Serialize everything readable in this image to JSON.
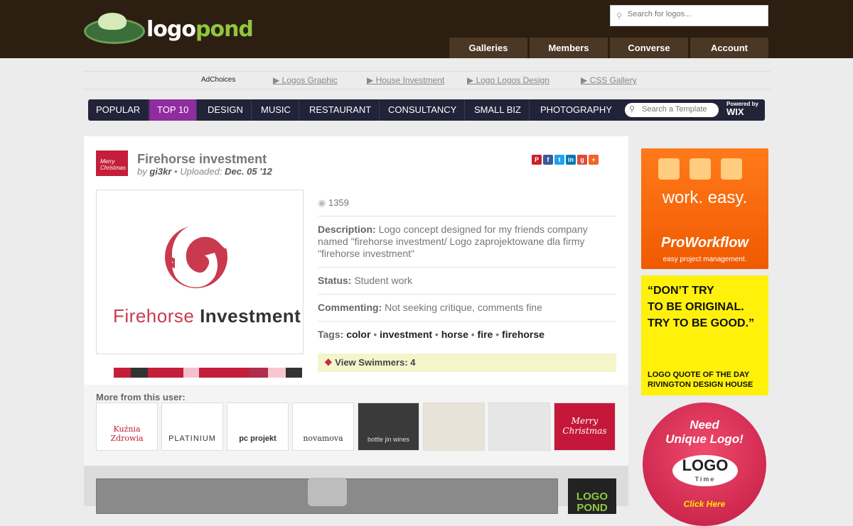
{
  "header": {
    "logo_white": "logo",
    "logo_green": "pond",
    "search_placeholder": "Search for logos...",
    "nav": [
      "Galleries",
      "Members",
      "Converse",
      "Account"
    ]
  },
  "adbar": {
    "adchoices": "AdChoices",
    "links": [
      "▶ Logos Graphic",
      "▶ House Investment",
      "▶ Logo Logos Design",
      "▶ CSS Gallery"
    ]
  },
  "categories": {
    "items": [
      "POPULAR",
      "TOP 10",
      "DESIGN",
      "MUSIC",
      "RESTAURANT",
      "CONSULTANCY",
      "SMALL BIZ",
      "PHOTOGRAPHY"
    ],
    "active": "TOP 10",
    "search_placeholder": "Search a Template",
    "wix_top": "Powered by",
    "wix": "WIX"
  },
  "logo_page": {
    "avatar_text": "Merry Christmas",
    "title": "Firehorse investment",
    "by_prefix": "by",
    "author": "gi3kr",
    "uploaded_prefix": " • Uploaded:",
    "uploaded_date": "Dec. 05 '12",
    "logo_word1": "Firehorse",
    "logo_word2": "Investment",
    "swatch_colors": [
      "#c41e3a",
      "#333333",
      "#c41e3a",
      "#f3c0cb",
      "#c41e3a",
      "#b12d4d",
      "#c41e3a",
      "#f7c6d0",
      "#333333"
    ],
    "views": "1359",
    "description_label": "Description:",
    "description": "Logo concept designed for my friends company named \"firehorse investment/ Logo zaprojektowane dla firmy \"firehorse investment\"",
    "status_label": "Status:",
    "status": "Student work",
    "commenting_label": "Commenting:",
    "commenting": "Not seeking critique, comments fine",
    "tags_label": "Tags:",
    "tags": [
      "color",
      "investment",
      "horse",
      "fire",
      "firehorse"
    ],
    "swimmers": "View Swimmers: 4"
  },
  "more": {
    "heading": "More from this user:",
    "thumbs": [
      "Kuźnia Zdrowia",
      "PLATINIUM",
      "pc projekt",
      "novamova",
      "bottle jin wines",
      "",
      "",
      "Merry Christmas"
    ]
  },
  "bottom": {
    "lp_small": "LOGO POND"
  },
  "ads": {
    "proworkflow_slogan": "work. easy.",
    "proworkflow_name": "ProWorkflow",
    "proworkflow_sub": "easy project management.",
    "quote_lines": [
      "“DON’T TRY",
      "TO BE ORIGINAL.",
      "TRY TO BE GOOD.”"
    ],
    "quote_source": [
      "LOGO QUOTE OF THE DAY",
      "RIVINGTON DESIGN HOUSE"
    ],
    "logotime_need": "Need",
    "logotime_unique": "Unique Logo!",
    "logotime_logo": "LOGO",
    "logotime_time": "Time",
    "logotime_cta": "Click Here"
  },
  "colors": {
    "header_bg": "#2c1e10",
    "brand_green": "#8fc63f",
    "nav_tab": "#4a3724",
    "cat_active": "#8e2ca0",
    "firehorse_red": "#c41e3a"
  }
}
